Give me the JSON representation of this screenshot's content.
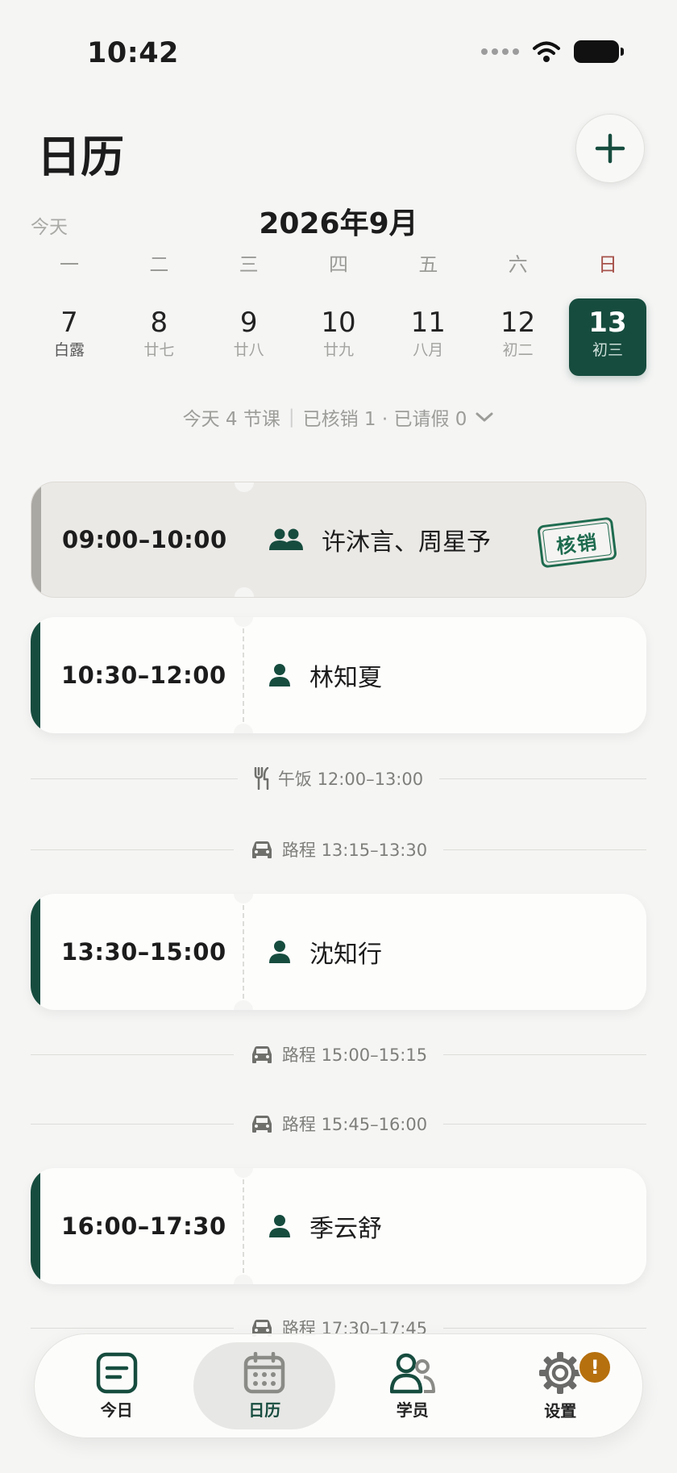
{
  "status_bar": {
    "time": "10:42"
  },
  "header": {
    "title": "日历",
    "add_label": "+"
  },
  "calendar": {
    "today_link": "今天",
    "month_label": "2026年9月",
    "weekdays": [
      "一",
      "二",
      "三",
      "四",
      "五",
      "六",
      "日"
    ],
    "days": [
      {
        "num": "7",
        "sub": "白露"
      },
      {
        "num": "8",
        "sub": "廿七"
      },
      {
        "num": "9",
        "sub": "廿八"
      },
      {
        "num": "10",
        "sub": "廿九"
      },
      {
        "num": "11",
        "sub": "八月"
      },
      {
        "num": "12",
        "sub": "初二"
      },
      {
        "num": "13",
        "sub": "初三",
        "selected": true
      }
    ],
    "summary": {
      "lessons": "今天 4 节课",
      "checked": "已核销 1 · 已请假 0"
    }
  },
  "schedule": {
    "lessons": [
      {
        "time": "09:00–10:00",
        "people": "许沐言、周星予",
        "stamp": "核销",
        "status": "checked"
      },
      {
        "time": "10:30–12:00",
        "people": "林知夏"
      },
      {
        "time": "13:30–15:00",
        "people": "沈知行"
      },
      {
        "time": "16:00–17:30",
        "people": "季云舒"
      }
    ],
    "gaps": [
      {
        "label": "午饭 12:00–13:00",
        "icon": "utensils-icon"
      },
      {
        "label": "路程 13:15–13:30",
        "icon": "car-icon"
      },
      {
        "label": "路程 15:00–15:15",
        "icon": "car-icon"
      },
      {
        "label": "路程 15:45–16:00",
        "icon": "car-icon"
      },
      {
        "label": "路程 17:30–17:45",
        "icon": "car-icon"
      }
    ]
  },
  "tabs": [
    {
      "label": "今日",
      "icon": "today-icon"
    },
    {
      "label": "日历",
      "icon": "calendar-icon",
      "active": true
    },
    {
      "label": "学员",
      "icon": "students-icon"
    },
    {
      "label": "设置",
      "icon": "gear-icon",
      "badge": "!"
    }
  ],
  "colors": {
    "accent": "#164c3e",
    "background": "#f5f5f4",
    "sunday": "#a6524a",
    "badge": "#b6700e",
    "checked_card": "#ebe9e6"
  }
}
